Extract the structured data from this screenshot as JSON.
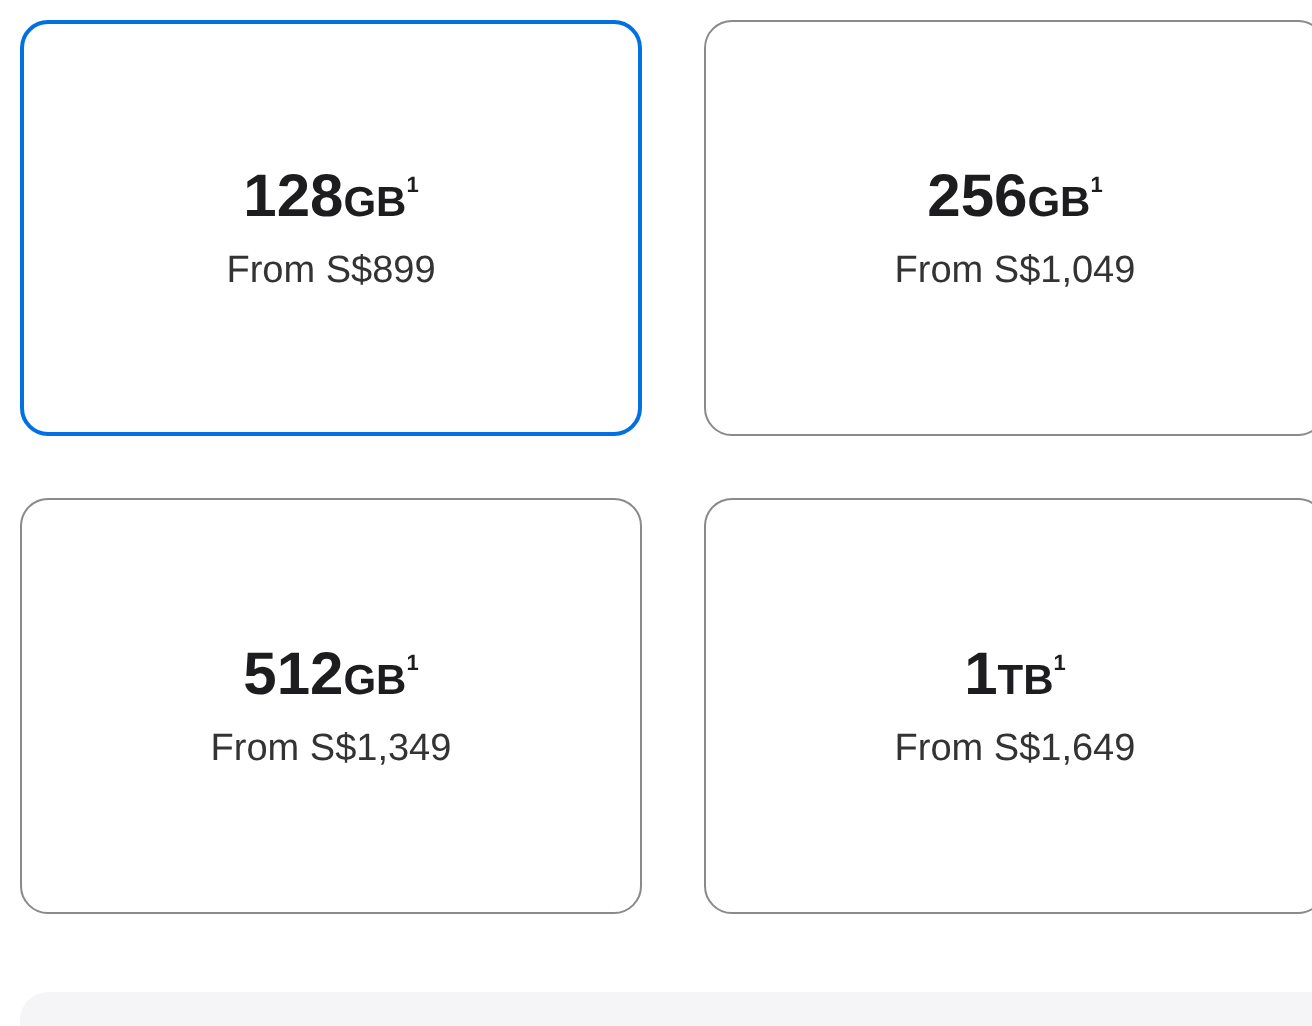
{
  "options": [
    {
      "size": "128",
      "unit": "GB",
      "note": "1",
      "price": "From S$899",
      "selected": true
    },
    {
      "size": "256",
      "unit": "GB",
      "note": "1",
      "price": "From S$1,049",
      "selected": false
    },
    {
      "size": "512",
      "unit": "GB",
      "note": "1",
      "price": "From S$1,349",
      "selected": false
    },
    {
      "size": "1",
      "unit": "TB",
      "note": "1",
      "price": "From S$1,649",
      "selected": false
    }
  ]
}
